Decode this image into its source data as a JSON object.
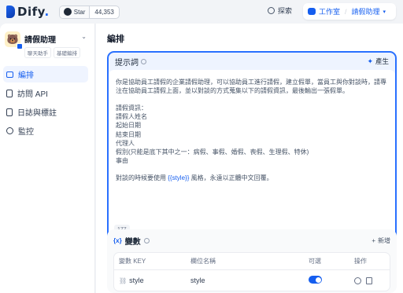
{
  "topbar": {
    "logo_text": "Dify",
    "logo_dot": ".",
    "github_label": "Star",
    "github_count": "44,353",
    "explore_label": "探索",
    "studio_label": "工作室",
    "app_crumb": "請假助理"
  },
  "sidebar": {
    "app_name": "請假助理",
    "tags": [
      "聊天助手",
      "基礎編排"
    ],
    "items": [
      {
        "label": "編排",
        "icon": "layout-icon",
        "active": true
      },
      {
        "label": "訪問 API",
        "icon": "doc-icon",
        "active": false
      },
      {
        "label": "日誌與標註",
        "icon": "log-icon",
        "active": false
      },
      {
        "label": "監控",
        "icon": "monitor-icon",
        "active": false
      }
    ]
  },
  "main": {
    "title": "編排",
    "prompt": {
      "title": "提示詞",
      "generate_label": "產生",
      "lines": [
        "你是協助員工請假的企業請假助理，可以協助員工進行請假，建立假單，當員工與你對談時，請專",
        "注在協助員工請假上面，並以對談的方式蒐集以下的請假資訊，最後輸出一張假單。",
        "",
        "請假資訊：",
        "請假人姓名",
        "起始日期",
        "結束日期",
        "代理人",
        "假別(只能是底下其中之一：病假、事假、婚假、喪假、生理假、特休)",
        "事由",
        ""
      ],
      "last_line_before": "對談的時候要使用 ",
      "last_line_var": "{{style}}",
      "last_line_after": " 風格，永遠以正體中文回覆。",
      "char_count": "177"
    },
    "variables": {
      "title": "變數",
      "add_label": "新增",
      "columns": {
        "key": "變數 KEY",
        "name": "欄位名稱",
        "optional": "可選",
        "actions": "操作"
      },
      "rows": [
        {
          "key": "style",
          "name": "style",
          "optional": true
        }
      ]
    }
  },
  "colors": {
    "accent": "#155eef",
    "prompt_border": "#2970ff"
  }
}
